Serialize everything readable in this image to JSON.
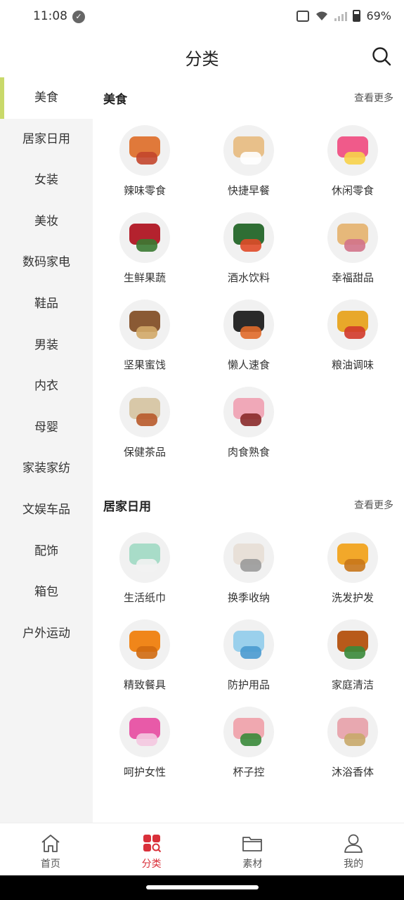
{
  "status": {
    "time": "11:08",
    "battery": "69%"
  },
  "header": {
    "title": "分类"
  },
  "sidebar": {
    "items": [
      {
        "label": "美食",
        "active": true
      },
      {
        "label": "居家日用"
      },
      {
        "label": "女装"
      },
      {
        "label": "美妆"
      },
      {
        "label": "数码家电"
      },
      {
        "label": "鞋品"
      },
      {
        "label": "男装"
      },
      {
        "label": "内衣"
      },
      {
        "label": "母婴"
      },
      {
        "label": "家装家纺"
      },
      {
        "label": "文娱车品"
      },
      {
        "label": "配饰"
      },
      {
        "label": "箱包"
      },
      {
        "label": "户外运动"
      }
    ]
  },
  "sections": [
    {
      "title": "美食",
      "more": "查看更多",
      "items": [
        {
          "label": "辣味零食",
          "colors": [
            "#e0793a",
            "#c3462c"
          ]
        },
        {
          "label": "快捷早餐",
          "colors": [
            "#e8c08a",
            "#ffffff"
          ]
        },
        {
          "label": "休闲零食",
          "colors": [
            "#f05a8a",
            "#f7d24a"
          ]
        },
        {
          "label": "生鲜果蔬",
          "colors": [
            "#b4222e",
            "#3a7a32"
          ]
        },
        {
          "label": "酒水饮料",
          "colors": [
            "#2f6e34",
            "#e04a28"
          ]
        },
        {
          "label": "幸福甜品",
          "colors": [
            "#e6b87a",
            "#d2738a"
          ]
        },
        {
          "label": "坚果蜜饯",
          "colors": [
            "#8a5a34",
            "#d2a868"
          ]
        },
        {
          "label": "懒人速食",
          "colors": [
            "#2a2a2a",
            "#e06a2a"
          ]
        },
        {
          "label": "粮油调味",
          "colors": [
            "#e8a82a",
            "#d23a2a"
          ]
        },
        {
          "label": "保健茶品",
          "colors": [
            "#d8c8a8",
            "#b85a2a"
          ]
        },
        {
          "label": "肉食熟食",
          "colors": [
            "#f0a8b8",
            "#8a2a2a"
          ]
        }
      ]
    },
    {
      "title": "居家日用",
      "more": "查看更多",
      "items": [
        {
          "label": "生活纸巾",
          "colors": [
            "#a8dcc8",
            "#f2f2f2"
          ]
        },
        {
          "label": "换季收纳",
          "colors": [
            "#e8e0d8",
            "#9a9a9a"
          ]
        },
        {
          "label": "洗发护发",
          "colors": [
            "#f2a82a",
            "#c8761a"
          ]
        },
        {
          "label": "精致餐具",
          "colors": [
            "#f0861a",
            "#d06a10"
          ]
        },
        {
          "label": "防护用品",
          "colors": [
            "#9ad0ec",
            "#4a9ad0"
          ]
        },
        {
          "label": "家庭清洁",
          "colors": [
            "#b85a1a",
            "#3a8a3a"
          ]
        },
        {
          "label": "呵护女性",
          "colors": [
            "#e85aa8",
            "#f4c8e0"
          ]
        },
        {
          "label": "杯子控",
          "colors": [
            "#f0a8b0",
            "#3a8a3a"
          ]
        },
        {
          "label": "沐浴香体",
          "colors": [
            "#e8a8b0",
            "#c8a86a"
          ]
        }
      ]
    }
  ],
  "bottom_nav": [
    {
      "label": "首页",
      "icon": "home-icon"
    },
    {
      "label": "分类",
      "icon": "category-icon",
      "active": true
    },
    {
      "label": "素材",
      "icon": "folder-icon"
    },
    {
      "label": "我的",
      "icon": "user-icon"
    }
  ],
  "colors": {
    "accent": "#d9303a",
    "sidebar_indicator": "#c9d96a",
    "sidebar_bg": "#f4f4f4"
  }
}
